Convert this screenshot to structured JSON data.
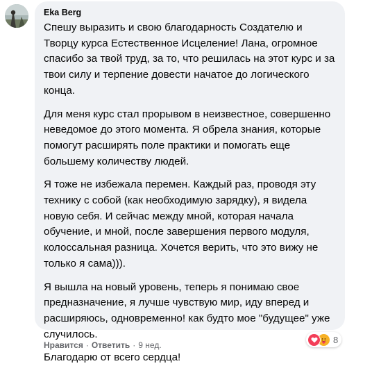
{
  "comment": {
    "author": "Eka Berg",
    "paragraphs": [
      "Спешу выразить и свою благодарность Создателю и Творцу курса Естественное Исцеление! Лана, огромное спасибо за твой труд, за то, что решилась на этот курс и за твои силу и терпение довести начатое до логического конца.",
      "Для меня курс стал прорывом в неизвестное, совершенно неведомое до этого момента. Я обрела знания, которые помогут расширять поле практики и помогать еще большему количеству людей.",
      "Я тоже не избежала перемен. Каждый раз, проводя эту технику с собой (как необходимую зарядку), я видела новую себя. И сейчас между мной, которая начала обучение, и мной, после завершения первого модуля, колоссальная разница. Хочется верить, что это вижу не только я сама))).",
      "Я вышла на новый уровень, теперь я понимаю свое предназначение, я лучше чувствую мир, иду вперед и расширяюсь, одновременно! как будто мое \"будущее\" уже случилось.",
      "Благодарю от всего сердца!"
    ]
  },
  "actions": {
    "like_label": "Нравится",
    "reply_label": "Ответить",
    "separator": "·",
    "time": "9 нед."
  },
  "reactions": {
    "icons": [
      "heart-icon",
      "care-icon"
    ],
    "count": "8"
  },
  "colors": {
    "bubble_bg": "#f0f2f5",
    "text": "#050505",
    "secondary_text": "#65676b",
    "love": "#f33e58",
    "care": "#f7b125"
  }
}
